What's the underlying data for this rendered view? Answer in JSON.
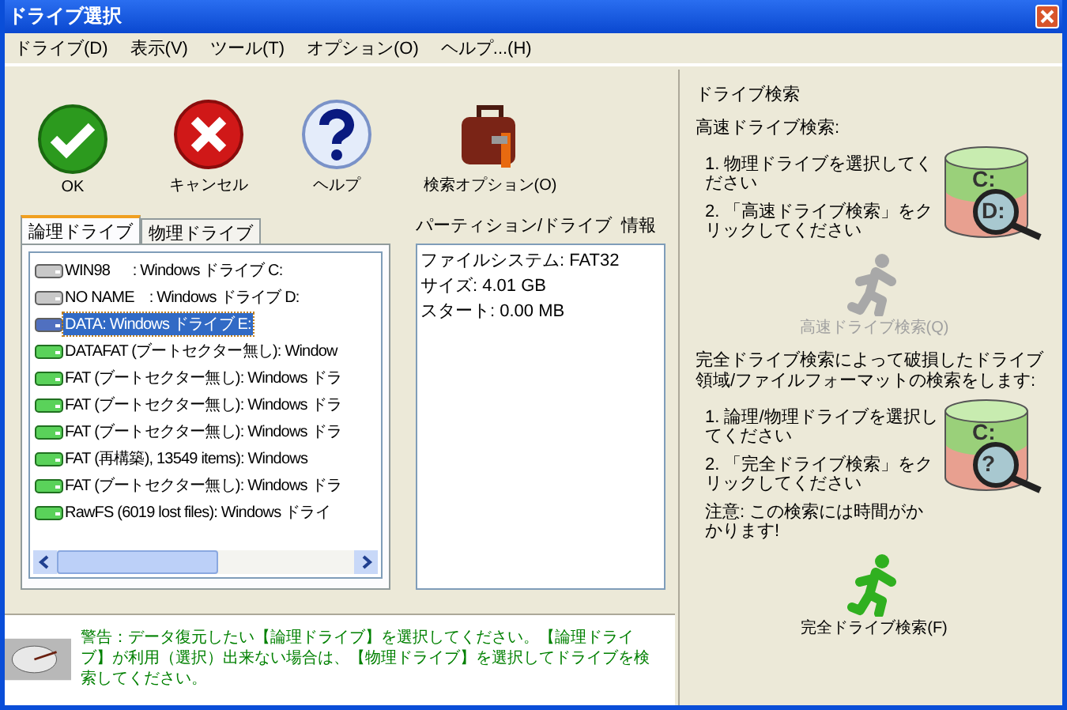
{
  "window": {
    "title": "ドライブ選択"
  },
  "menu": [
    "ドライブ(D)",
    "表示(V)",
    "ツール(T)",
    "オプション(O)",
    "ヘルプ...(H)"
  ],
  "toolbar": [
    {
      "kind": "ok",
      "label": "OK"
    },
    {
      "kind": "cancel",
      "label": "キャンセル"
    },
    {
      "kind": "help",
      "label": "ヘルプ"
    },
    {
      "kind": "options",
      "label": "検索オプション(O)"
    }
  ],
  "tabs": [
    {
      "label": "論理ドライブ",
      "selected": true
    },
    {
      "label": "物理ドライブ",
      "selected": false
    }
  ],
  "drives": [
    {
      "label": "WIN98      : Windows ドライブ C:",
      "kind": "existing",
      "selected": false
    },
    {
      "label": "NO NAME    : Windows ドライブ D:",
      "kind": "existing",
      "selected": false
    },
    {
      "label": "DATA: Windows ドライブ E:",
      "kind": "existing",
      "selected": true
    },
    {
      "label": "DATAFAT (ブートセクター無し): Window",
      "kind": "found",
      "selected": false
    },
    {
      "label": "FAT (ブートセクター無し): Windows ドラ",
      "kind": "found",
      "selected": false
    },
    {
      "label": "FAT (ブートセクター無し): Windows ドラ",
      "kind": "found",
      "selected": false
    },
    {
      "label": "FAT (ブートセクター無し): Windows ドラ",
      "kind": "found",
      "selected": false
    },
    {
      "label": "FAT (再構築), 13549 items): Windows",
      "kind": "found",
      "selected": false
    },
    {
      "label": "FAT (ブートセクター無し): Windows ドラ",
      "kind": "found",
      "selected": false
    },
    {
      "label": "RawFS (6019 lost files): Windows ドライ",
      "kind": "found",
      "selected": false
    }
  ],
  "partition_info": {
    "title": "パーティション/ドライブ  情報",
    "lines": [
      "ファイルシステム: FAT32",
      "サイズ: 4.01 GB",
      "スタート: 0.00 MB"
    ]
  },
  "warning": "警告：データ復元したい【論理ドライブ】を選択してください。【論理ドライブ】が利用（選択）出来ない場合は、【物理ドライブ】を選択してドライブを検索してください。",
  "search_panel": {
    "title": "ドライブ検索",
    "quick": {
      "heading": "高速ドライブ検索:",
      "steps": [
        "1. 物理ドライブを選択してください",
        "2. 「高速ドライブ検索」をクリックしてください"
      ],
      "image_labels": [
        "C:",
        "D:"
      ],
      "button": "高速ドライブ検索(Q)",
      "disabled": true
    },
    "full": {
      "heading": "完全ドライブ検索によって破損したドライブ領域/ファイルフォーマットの検索をします:",
      "steps": [
        "1. 論理/物理ドライブを選択してください",
        "2. 「完全ドライブ検索」をクリックしてください",
        "注意: この検索には時間がかかります!"
      ],
      "image_labels": [
        "C:",
        "?"
      ],
      "button": "完全ドライブ検索(F)",
      "disabled": false
    }
  }
}
